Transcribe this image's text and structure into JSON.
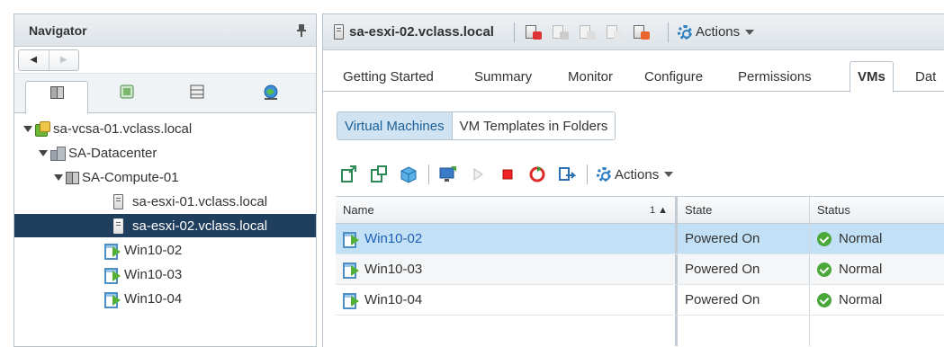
{
  "navigator": {
    "title": "Navigator",
    "tree": {
      "vcenter": "sa-vcsa-01.vclass.local",
      "datacenter": "SA-Datacenter",
      "cluster": "SA-Compute-01",
      "hosts": [
        "sa-esxi-01.vclass.local",
        "sa-esxi-02.vclass.local"
      ],
      "vms": [
        "Win10-02",
        "Win10-03",
        "Win10-04"
      ]
    },
    "tabs": [
      "hosts-and-clusters-icon",
      "vms-and-templates-icon",
      "storage-icon",
      "networking-icon"
    ]
  },
  "object": {
    "title": "sa-esxi-02.vclass.local",
    "actions_label": "Actions"
  },
  "tabs": [
    "Getting Started",
    "Summary",
    "Monitor",
    "Configure",
    "Permissions",
    "VMs",
    "Dat"
  ],
  "subtabs": [
    "Virtual Machines",
    "VM Templates in Folders"
  ],
  "toolbar": {
    "actions_label": "Actions"
  },
  "grid": {
    "columns": [
      "Name",
      "State",
      "Status"
    ],
    "sort_indicator": "1 ▲",
    "rows": [
      {
        "name": "Win10-02",
        "state": "Powered On",
        "status": "Normal"
      },
      {
        "name": "Win10-03",
        "state": "Powered On",
        "status": "Normal"
      },
      {
        "name": "Win10-04",
        "state": "Powered On",
        "status": "Normal"
      }
    ]
  },
  "colors": {
    "selection_dark": "#203e5e",
    "selection_light": "#c3e1f6",
    "link_blue": "#1e5fb5",
    "status_ok": "#4aa83a"
  }
}
